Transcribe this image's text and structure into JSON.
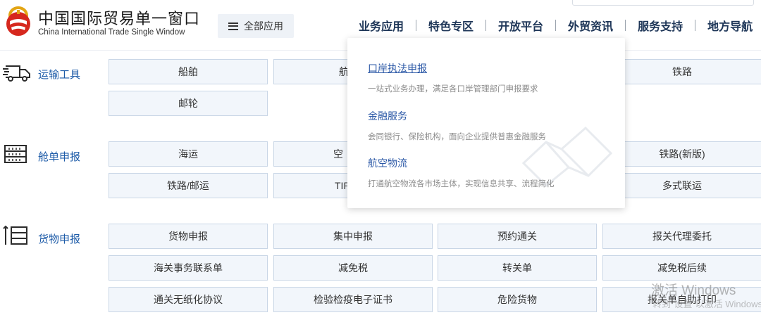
{
  "header": {
    "brand_cn": "中国国际贸易单一窗口",
    "brand_en": "China International Trade Single Window",
    "all_apps_label": "全部应用",
    "nav": [
      "业务应用",
      "特色专区",
      "开放平台",
      "外贸资讯",
      "服务支持",
      "地方导航"
    ]
  },
  "categories": [
    {
      "label": "运输工具",
      "icon": "truck-icon",
      "rows": [
        [
          "船舶",
          "航",
          "",
          "铁路"
        ],
        [
          "邮轮"
        ]
      ]
    },
    {
      "label": "舱单申报",
      "icon": "manifest-icon",
      "rows": [
        [
          "海运",
          "空",
          "",
          "铁路(新版)"
        ],
        [
          "铁路/邮运",
          "TIR",
          "",
          "多式联运"
        ]
      ]
    },
    {
      "label": "货物申报",
      "icon": "cargo-icon",
      "rows": [
        [
          "货物申报",
          "集中申报",
          "预约通关",
          "报关代理委托"
        ],
        [
          "海关事务联系单",
          "减免税",
          "转关单",
          "减免税后续"
        ],
        [
          "通关无纸化协议",
          "检验检疫电子证书",
          "危险货物",
          "报关单自助打印"
        ]
      ]
    }
  ],
  "dropdown": {
    "items": [
      {
        "title": "口岸执法申报",
        "desc": "一站式业务办理，满足各口岸管理部门申报要求"
      },
      {
        "title": "金融服务",
        "desc": "会同银行、保险机构，面向企业提供普惠金融服务"
      },
      {
        "title": "航空物流",
        "desc": "打通航空物流各市场主体，实现信息共享、流程简化"
      }
    ]
  },
  "watermark": {
    "line1": "激活 Windows",
    "line2": "转到“设置”以激活 Windows"
  },
  "colors": {
    "nav_text": "#1d3557",
    "category_label": "#1d5ba8",
    "cell_bg": "#f2f6fb",
    "cell_border": "#c9d6e6",
    "dropdown_title": "#2a57a6",
    "logo_red": "#d6281e",
    "logo_gold": "#e3a514"
  }
}
